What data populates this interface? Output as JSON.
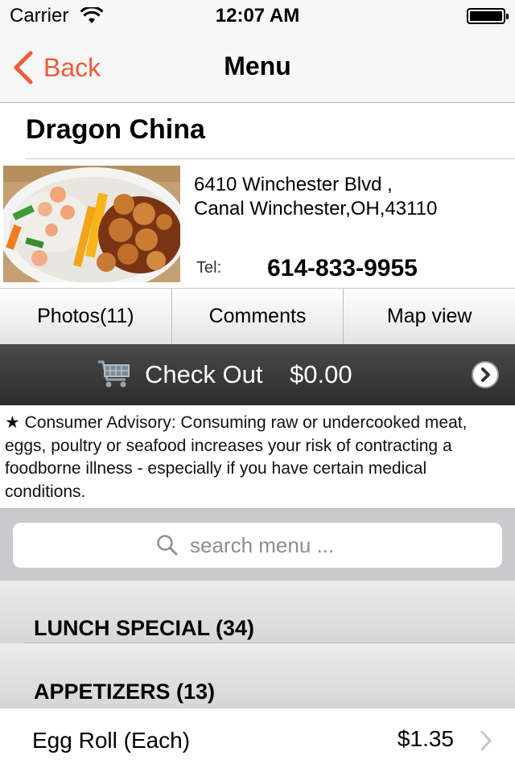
{
  "status_bar": {
    "carrier": "Carrier",
    "time": "12:07 AM"
  },
  "nav": {
    "back_label": "Back",
    "title": "Menu"
  },
  "restaurant": {
    "name": "Dragon China",
    "address_line1": "6410 Winchester Blvd ,",
    "address_line2": "Canal Winchester,OH,43110",
    "tel_label": "Tel:",
    "tel_number": "614-833-9955"
  },
  "tabs": [
    {
      "label": "Photos(11)"
    },
    {
      "label": "Comments"
    },
    {
      "label": "Map view"
    }
  ],
  "checkout": {
    "label": "Check Out",
    "amount": "$0.00"
  },
  "advisory": "★ Consumer Advisory: Consuming raw or undercooked meat, eggs, poultry or seafood increases your risk of contracting a foodborne illness - especially if you have certain medical conditions.",
  "search": {
    "placeholder": "search menu ..."
  },
  "sections": [
    {
      "label": "LUNCH SPECIAL (34)"
    },
    {
      "label": "APPETIZERS (13)"
    }
  ],
  "items": [
    {
      "name": "Egg Roll (Each)",
      "price": "$1.35"
    }
  ],
  "colors": {
    "accent": "#ef5a3b",
    "checkout_bar": "#333333",
    "search_bg": "#c9c9ce"
  }
}
